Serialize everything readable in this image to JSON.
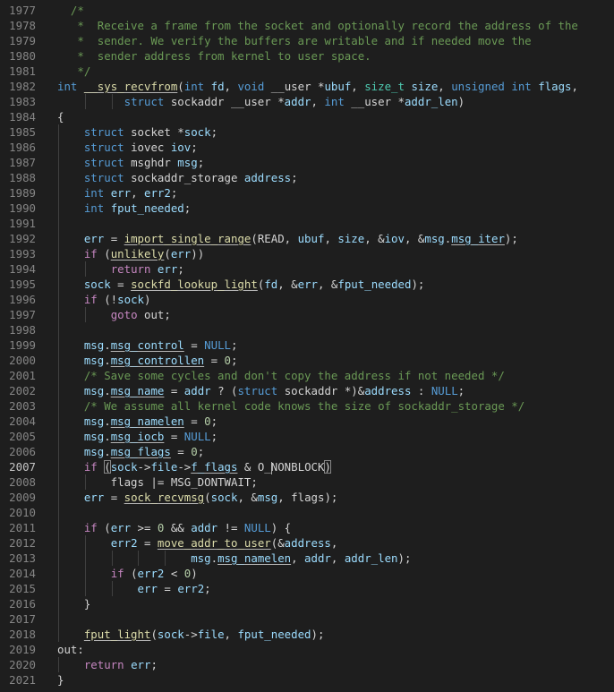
{
  "editor": {
    "language": "c",
    "theme_bg": "#1e1e1e",
    "current_line": "2007",
    "lines": [
      {
        "n": "1977",
        "t": [
          [
            "  /*",
            "cm"
          ]
        ]
      },
      {
        "n": "1978",
        "t": [
          [
            "   *  Receive a frame from the socket and optionally record the address of the",
            "cm"
          ]
        ]
      },
      {
        "n": "1979",
        "t": [
          [
            "   *  sender. We verify the buffers are writable and if needed move the",
            "cm"
          ]
        ]
      },
      {
        "n": "1980",
        "t": [
          [
            "   *  sender address from kernel to user space.",
            "cm"
          ]
        ]
      },
      {
        "n": "1981",
        "t": [
          [
            "   */",
            "cm"
          ]
        ]
      },
      {
        "n": "1982",
        "t": [
          [
            "int",
            "kw"
          ],
          [
            " ",
            "pl"
          ],
          [
            "__sys_recvfrom",
            "fn"
          ],
          [
            "(",
            "pl"
          ],
          [
            "int",
            "kw"
          ],
          [
            " ",
            "pl"
          ],
          [
            "fd",
            "prm"
          ],
          [
            ", ",
            "pl"
          ],
          [
            "void",
            "kw"
          ],
          [
            " __user *",
            "pl"
          ],
          [
            "ubuf",
            "prm"
          ],
          [
            ", ",
            "pl"
          ],
          [
            "size_t",
            "ty"
          ],
          [
            " ",
            "pl"
          ],
          [
            "size",
            "prm"
          ],
          [
            ", ",
            "pl"
          ],
          [
            "unsigned int",
            "kw"
          ],
          [
            " ",
            "pl"
          ],
          [
            "flags",
            "prm"
          ],
          [
            ",",
            "pl"
          ]
        ]
      },
      {
        "n": "1983",
        "t": [
          [
            "          ",
            "pl"
          ],
          [
            "struct",
            "kw"
          ],
          [
            " sockaddr __user *",
            "pl"
          ],
          [
            "addr",
            "prm"
          ],
          [
            ", ",
            "pl"
          ],
          [
            "int",
            "kw"
          ],
          [
            " __user *",
            "pl"
          ],
          [
            "addr_len",
            "prm"
          ],
          [
            ")",
            "pl"
          ]
        ]
      },
      {
        "n": "1984",
        "t": [
          [
            "{",
            "pl"
          ]
        ]
      },
      {
        "n": "1985",
        "t": [
          [
            "    ",
            "pl"
          ],
          [
            "struct",
            "kw"
          ],
          [
            " socket *",
            "pl"
          ],
          [
            "sock",
            "var"
          ],
          [
            ";",
            "pl"
          ]
        ]
      },
      {
        "n": "1986",
        "t": [
          [
            "    ",
            "pl"
          ],
          [
            "struct",
            "kw"
          ],
          [
            " iovec ",
            "pl"
          ],
          [
            "iov",
            "var"
          ],
          [
            ";",
            "pl"
          ]
        ]
      },
      {
        "n": "1987",
        "t": [
          [
            "    ",
            "pl"
          ],
          [
            "struct",
            "kw"
          ],
          [
            " msghdr ",
            "pl"
          ],
          [
            "msg",
            "var"
          ],
          [
            ";",
            "pl"
          ]
        ]
      },
      {
        "n": "1988",
        "t": [
          [
            "    ",
            "pl"
          ],
          [
            "struct",
            "kw"
          ],
          [
            " sockaddr_storage ",
            "pl"
          ],
          [
            "address",
            "var"
          ],
          [
            ";",
            "pl"
          ]
        ]
      },
      {
        "n": "1989",
        "t": [
          [
            "    ",
            "pl"
          ],
          [
            "int",
            "kw"
          ],
          [
            " ",
            "pl"
          ],
          [
            "err",
            "var"
          ],
          [
            ", ",
            "pl"
          ],
          [
            "err2",
            "var"
          ],
          [
            ";",
            "pl"
          ]
        ]
      },
      {
        "n": "1990",
        "t": [
          [
            "    ",
            "pl"
          ],
          [
            "int",
            "kw"
          ],
          [
            " ",
            "pl"
          ],
          [
            "fput_needed",
            "var"
          ],
          [
            ";",
            "pl"
          ]
        ]
      },
      {
        "n": "1991",
        "t": []
      },
      {
        "n": "1992",
        "t": [
          [
            "    ",
            "pl"
          ],
          [
            "err",
            "var"
          ],
          [
            " = ",
            "pl"
          ],
          [
            "import_single_range",
            "fn"
          ],
          [
            "(READ, ",
            "pl"
          ],
          [
            "ubuf",
            "var"
          ],
          [
            ", ",
            "pl"
          ],
          [
            "size",
            "var"
          ],
          [
            ", &",
            "pl"
          ],
          [
            "iov",
            "var"
          ],
          [
            ", &",
            "pl"
          ],
          [
            "msg",
            "var"
          ],
          [
            ".",
            "pl"
          ],
          [
            "msg_iter",
            "var"
          ],
          [
            ");",
            "pl"
          ]
        ]
      },
      {
        "n": "1993",
        "t": [
          [
            "    ",
            "pl"
          ],
          [
            "if",
            "ctl"
          ],
          [
            " (",
            "pl"
          ],
          [
            "unlikely",
            "fn"
          ],
          [
            "(",
            "pl"
          ],
          [
            "err",
            "var"
          ],
          [
            "))",
            "pl"
          ]
        ]
      },
      {
        "n": "1994",
        "t": [
          [
            "        ",
            "pl"
          ],
          [
            "return",
            "ctl"
          ],
          [
            " ",
            "pl"
          ],
          [
            "err",
            "var"
          ],
          [
            ";",
            "pl"
          ]
        ]
      },
      {
        "n": "1995",
        "t": [
          [
            "    ",
            "pl"
          ],
          [
            "sock",
            "var"
          ],
          [
            " = ",
            "pl"
          ],
          [
            "sockfd_lookup_light",
            "fn"
          ],
          [
            "(",
            "pl"
          ],
          [
            "fd",
            "var"
          ],
          [
            ", &",
            "pl"
          ],
          [
            "err",
            "var"
          ],
          [
            ", &",
            "pl"
          ],
          [
            "fput_needed",
            "var"
          ],
          [
            ");",
            "pl"
          ]
        ]
      },
      {
        "n": "1996",
        "t": [
          [
            "    ",
            "pl"
          ],
          [
            "if",
            "ctl"
          ],
          [
            " (!",
            "pl"
          ],
          [
            "sock",
            "var"
          ],
          [
            ")",
            "pl"
          ]
        ]
      },
      {
        "n": "1997",
        "t": [
          [
            "        ",
            "pl"
          ],
          [
            "goto",
            "ctl"
          ],
          [
            " out;",
            "pl"
          ]
        ]
      },
      {
        "n": "1998",
        "t": []
      },
      {
        "n": "1999",
        "t": [
          [
            "    ",
            "pl"
          ],
          [
            "msg",
            "var"
          ],
          [
            ".",
            "pl"
          ],
          [
            "msg_control",
            "var"
          ],
          [
            " = ",
            "pl"
          ],
          [
            "NULL",
            "mac"
          ],
          [
            ";",
            "pl"
          ]
        ]
      },
      {
        "n": "2000",
        "t": [
          [
            "    ",
            "pl"
          ],
          [
            "msg",
            "var"
          ],
          [
            ".",
            "pl"
          ],
          [
            "msg_controllen",
            "var"
          ],
          [
            " = ",
            "pl"
          ],
          [
            "0",
            "num"
          ],
          [
            ";",
            "pl"
          ]
        ]
      },
      {
        "n": "2001",
        "t": [
          [
            "    ",
            "pl"
          ],
          [
            "/* Save some cycles and don't copy the address if not needed */",
            "cm"
          ]
        ]
      },
      {
        "n": "2002",
        "t": [
          [
            "    ",
            "pl"
          ],
          [
            "msg",
            "var"
          ],
          [
            ".",
            "pl"
          ],
          [
            "msg_name",
            "var"
          ],
          [
            " = ",
            "pl"
          ],
          [
            "addr",
            "var"
          ],
          [
            " ? (",
            "pl"
          ],
          [
            "struct",
            "kw"
          ],
          [
            " sockaddr *)&",
            "pl"
          ],
          [
            "address",
            "var"
          ],
          [
            " : ",
            "pl"
          ],
          [
            "NULL",
            "mac"
          ],
          [
            ";",
            "pl"
          ]
        ]
      },
      {
        "n": "2003",
        "t": [
          [
            "    ",
            "pl"
          ],
          [
            "/* We assume all kernel code knows the size of sockaddr_storage */",
            "cm"
          ]
        ]
      },
      {
        "n": "2004",
        "t": [
          [
            "    ",
            "pl"
          ],
          [
            "msg",
            "var"
          ],
          [
            ".",
            "pl"
          ],
          [
            "msg_namelen",
            "var"
          ],
          [
            " = ",
            "pl"
          ],
          [
            "0",
            "num"
          ],
          [
            ";",
            "pl"
          ]
        ]
      },
      {
        "n": "2005",
        "t": [
          [
            "    ",
            "pl"
          ],
          [
            "msg",
            "var"
          ],
          [
            ".",
            "pl"
          ],
          [
            "msg_iocb",
            "var"
          ],
          [
            " = ",
            "pl"
          ],
          [
            "NULL",
            "mac"
          ],
          [
            ";",
            "pl"
          ]
        ]
      },
      {
        "n": "2006",
        "t": [
          [
            "    ",
            "pl"
          ],
          [
            "msg",
            "var"
          ],
          [
            ".",
            "pl"
          ],
          [
            "msg_flags",
            "var"
          ],
          [
            " = ",
            "pl"
          ],
          [
            "0",
            "num"
          ],
          [
            ";",
            "pl"
          ]
        ]
      },
      {
        "n": "2007",
        "t": [
          [
            "    ",
            "pl"
          ],
          [
            "if",
            "ctl"
          ],
          [
            " ",
            "pl"
          ],
          [
            "(",
            "bm"
          ],
          [
            "sock",
            "var"
          ],
          [
            "->",
            "pl"
          ],
          [
            "file",
            "var"
          ],
          [
            "->",
            "pl"
          ],
          [
            "f_flags",
            "var"
          ],
          [
            " & O_",
            "pl"
          ],
          [
            "|",
            "cur"
          ],
          [
            "NONBLOCK",
            "pl"
          ],
          [
            ")",
            "bm"
          ]
        ]
      },
      {
        "n": "2008",
        "t": [
          [
            "        flags |= MSG_DONTWAIT;",
            "pl"
          ]
        ]
      },
      {
        "n": "2009",
        "t": [
          [
            "    ",
            "pl"
          ],
          [
            "err",
            "var"
          ],
          [
            " = ",
            "pl"
          ],
          [
            "sock_recvmsg",
            "fn"
          ],
          [
            "(",
            "pl"
          ],
          [
            "sock",
            "var"
          ],
          [
            ", &",
            "pl"
          ],
          [
            "msg",
            "var"
          ],
          [
            ", flags);",
            "pl"
          ]
        ]
      },
      {
        "n": "2010",
        "t": []
      },
      {
        "n": "2011",
        "t": [
          [
            "    ",
            "pl"
          ],
          [
            "if",
            "ctl"
          ],
          [
            " (",
            "pl"
          ],
          [
            "err",
            "var"
          ],
          [
            " >= ",
            "pl"
          ],
          [
            "0",
            "num"
          ],
          [
            " && ",
            "pl"
          ],
          [
            "addr",
            "var"
          ],
          [
            " != ",
            "pl"
          ],
          [
            "NULL",
            "mac"
          ],
          [
            ") {",
            "pl"
          ]
        ]
      },
      {
        "n": "2012",
        "t": [
          [
            "        ",
            "pl"
          ],
          [
            "err2",
            "var"
          ],
          [
            " = ",
            "pl"
          ],
          [
            "move_addr_to_user",
            "fn"
          ],
          [
            "(&",
            "pl"
          ],
          [
            "address",
            "var"
          ],
          [
            ",",
            "pl"
          ]
        ]
      },
      {
        "n": "2013",
        "t": [
          [
            "                    ",
            "pl"
          ],
          [
            "msg",
            "var"
          ],
          [
            ".",
            "pl"
          ],
          [
            "msg_namelen",
            "var"
          ],
          [
            ", ",
            "pl"
          ],
          [
            "addr",
            "var"
          ],
          [
            ", ",
            "pl"
          ],
          [
            "addr_len",
            "var"
          ],
          [
            ");",
            "pl"
          ]
        ]
      },
      {
        "n": "2014",
        "t": [
          [
            "        ",
            "pl"
          ],
          [
            "if",
            "ctl"
          ],
          [
            " (",
            "pl"
          ],
          [
            "err2",
            "var"
          ],
          [
            " < ",
            "pl"
          ],
          [
            "0",
            "num"
          ],
          [
            ")",
            "pl"
          ]
        ]
      },
      {
        "n": "2015",
        "t": [
          [
            "            ",
            "pl"
          ],
          [
            "err",
            "var"
          ],
          [
            " = ",
            "pl"
          ],
          [
            "err2",
            "var"
          ],
          [
            ";",
            "pl"
          ]
        ]
      },
      {
        "n": "2016",
        "t": [
          [
            "    }",
            "pl"
          ]
        ]
      },
      {
        "n": "2017",
        "t": []
      },
      {
        "n": "2018",
        "t": [
          [
            "    ",
            "pl"
          ],
          [
            "fput_light",
            "fn"
          ],
          [
            "(",
            "pl"
          ],
          [
            "sock",
            "var"
          ],
          [
            "->",
            "pl"
          ],
          [
            "file",
            "var"
          ],
          [
            ", ",
            "pl"
          ],
          [
            "fput_needed",
            "var"
          ],
          [
            ");",
            "pl"
          ]
        ]
      },
      {
        "n": "2019",
        "t": [
          [
            "out:",
            "pl"
          ]
        ]
      },
      {
        "n": "2020",
        "t": [
          [
            "    ",
            "pl"
          ],
          [
            "return",
            "ctl"
          ],
          [
            " ",
            "pl"
          ],
          [
            "err",
            "var"
          ],
          [
            ";",
            "pl"
          ]
        ]
      },
      {
        "n": "2021",
        "t": [
          [
            "}",
            "pl"
          ]
        ]
      }
    ]
  }
}
